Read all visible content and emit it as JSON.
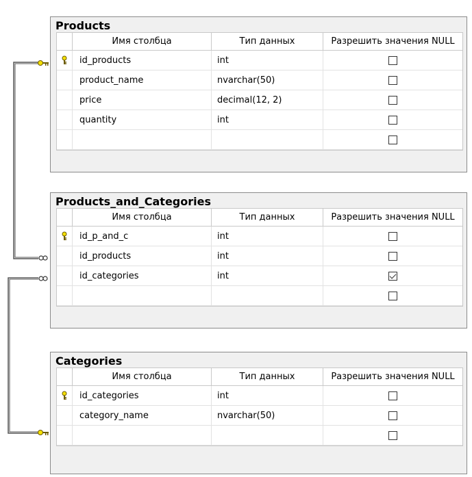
{
  "columns_header": {
    "name": "Имя столбца",
    "type": "Тип данных",
    "nullable": "Разрешить значения NULL"
  },
  "tables": [
    {
      "title": "Products",
      "rows": [
        {
          "name": "id_products",
          "type": "int",
          "allow_null": false,
          "primary_key": true
        },
        {
          "name": "product_name",
          "type": "nvarchar(50)",
          "allow_null": false,
          "primary_key": false
        },
        {
          "name": "price",
          "type": "decimal(12, 2)",
          "allow_null": false,
          "primary_key": false
        },
        {
          "name": "quantity",
          "type": "int",
          "allow_null": false,
          "primary_key": false
        },
        {
          "name": "",
          "type": "",
          "allow_null": false,
          "primary_key": false
        }
      ]
    },
    {
      "title": "Products_and_Categories",
      "rows": [
        {
          "name": "id_p_and_c",
          "type": "int",
          "allow_null": false,
          "primary_key": true
        },
        {
          "name": "id_products",
          "type": "int",
          "allow_null": false,
          "primary_key": false
        },
        {
          "name": "id_categories",
          "type": "int",
          "allow_null": true,
          "primary_key": false
        },
        {
          "name": "",
          "type": "",
          "allow_null": false,
          "primary_key": false
        }
      ]
    },
    {
      "title": "Categories",
      "rows": [
        {
          "name": "id_categories",
          "type": "int",
          "allow_null": false,
          "primary_key": true
        },
        {
          "name": "category_name",
          "type": "nvarchar(50)",
          "allow_null": false,
          "primary_key": false
        },
        {
          "name": "",
          "type": "",
          "allow_null": false,
          "primary_key": false
        }
      ]
    }
  ],
  "relationship_colors": {
    "line": "#555555",
    "key": "#e8d000"
  }
}
